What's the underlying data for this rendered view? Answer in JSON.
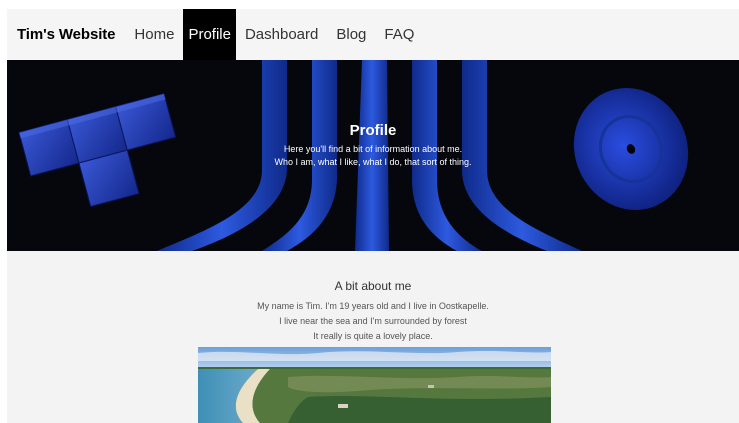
{
  "navbar": {
    "brand": "Tim's Website",
    "items": [
      {
        "label": "Home",
        "active": false
      },
      {
        "label": "Profile",
        "active": true
      },
      {
        "label": "Dashboard",
        "active": false
      },
      {
        "label": "Blog",
        "active": false
      },
      {
        "label": "FAQ",
        "active": false
      }
    ]
  },
  "hero": {
    "title": "Profile",
    "lines": [
      "Here you'll find a bit of information about me.",
      "Who I am, what I like, what I do, that sort of thing."
    ]
  },
  "about": {
    "title": "A bit about me",
    "lines": [
      "My name is Tim. I'm 19 years old and I live in Oostkapelle.",
      "I live near the sea and I'm surrounded by forest",
      "It really is quite a lovely place."
    ]
  },
  "colors": {
    "hero_bg": "#05070d",
    "stripe_blue": "#1f45c6",
    "nav_active_bg": "#000000"
  }
}
